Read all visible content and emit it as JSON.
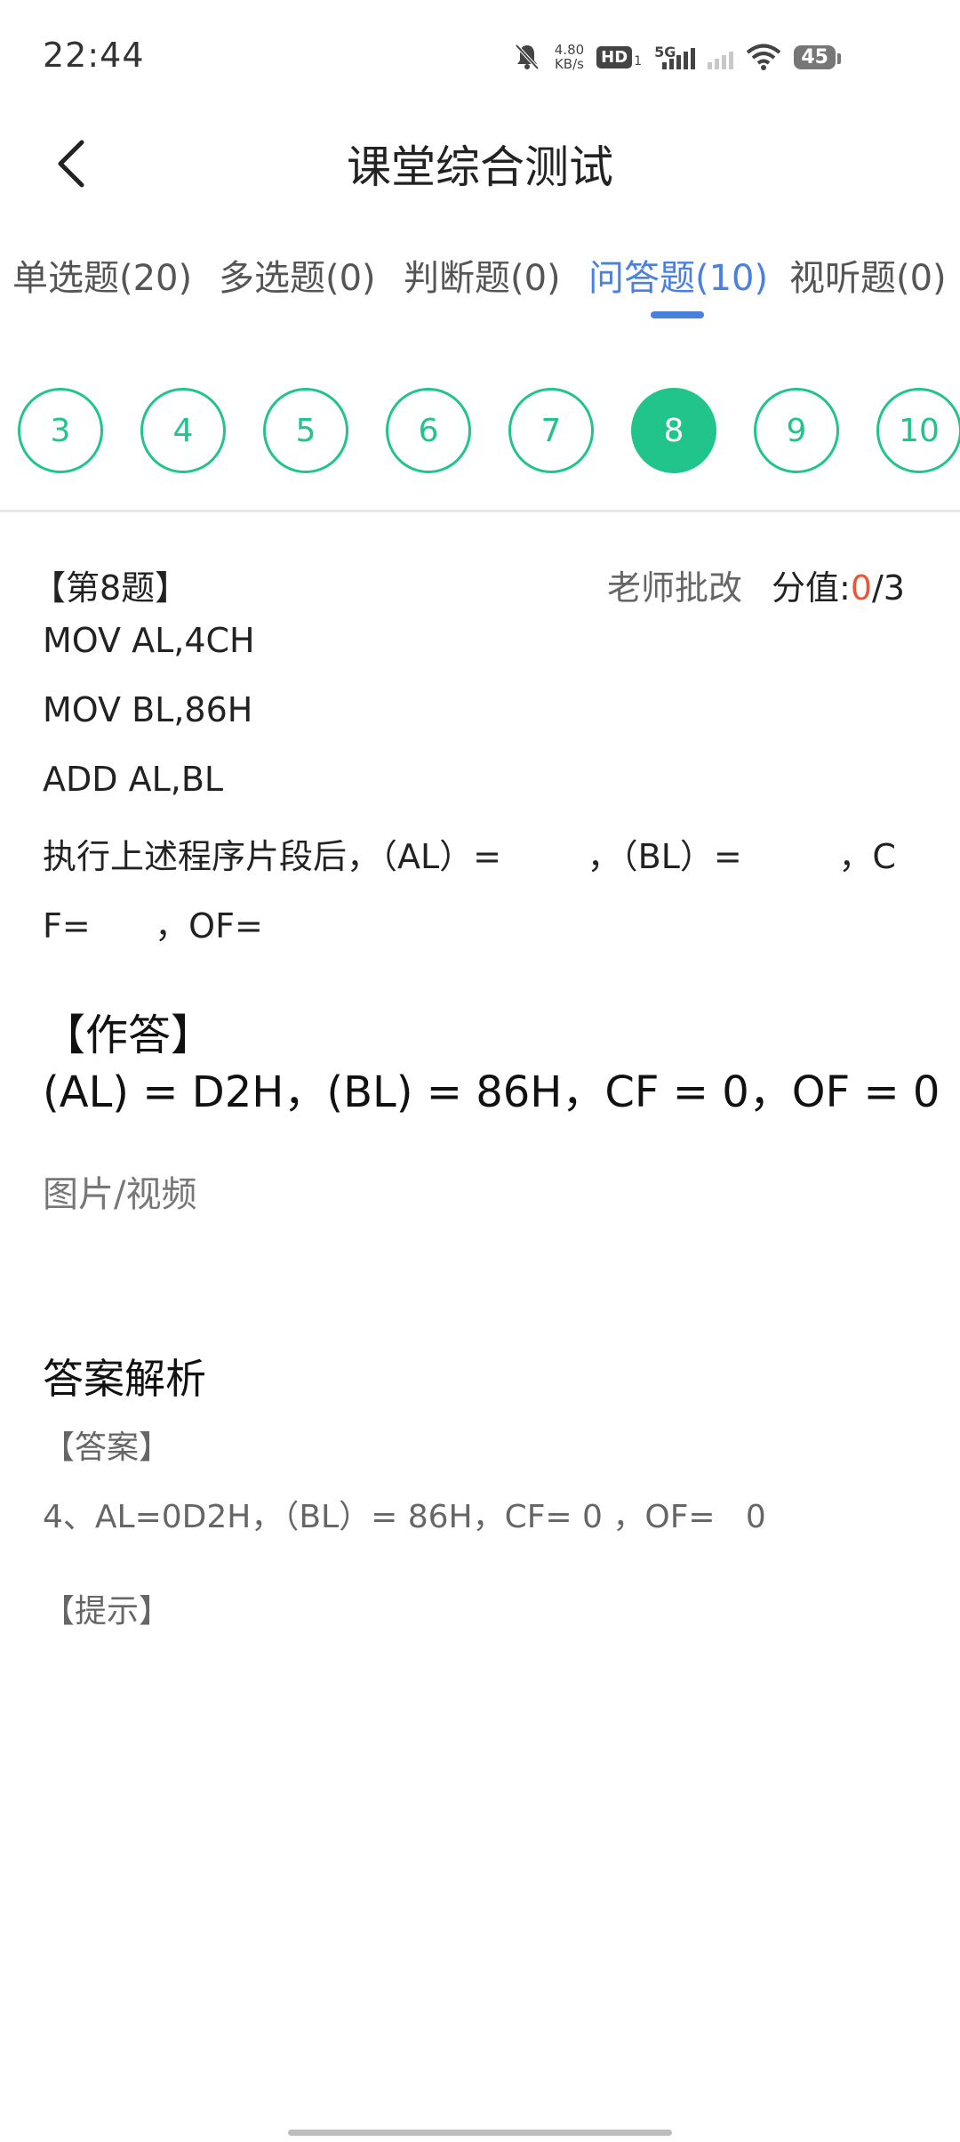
{
  "status_bar": {
    "time": "22:44",
    "net_speed_value": "4.80",
    "net_speed_unit": "KB/s",
    "hd_label": "HD",
    "hd_sub": "1",
    "network_type": "5G",
    "battery": "45"
  },
  "header": {
    "title": "课堂综合测试"
  },
  "tabs": [
    {
      "label": "单选题(20)"
    },
    {
      "label": "多选题(0)"
    },
    {
      "label": "判断题(0)"
    },
    {
      "label": "问答题(10)"
    },
    {
      "label": "视听题(0)"
    }
  ],
  "active_tab": 3,
  "question_nav": [
    "3",
    "4",
    "5",
    "6",
    "7",
    "8",
    "9",
    "10"
  ],
  "active_question": "8",
  "question": {
    "number_label": "【第8题】",
    "review_label": "老师批改",
    "score_label": "分值:",
    "score_got": "0",
    "score_total": "/3",
    "lines": [
      "MOV AL,4CH",
      "MOV BL,86H",
      "ADD AL,BL",
      "执行上述程序片段后，（AL）=        ，（BL）=         ，C",
      "F=      ，OF="
    ]
  },
  "my_answer": {
    "heading": "【作答】",
    "text": "(AL) = D2H，(BL) = 86H，CF = 0，OF = 0",
    "media_label": "图片/视频"
  },
  "analysis": {
    "heading": "答案解析",
    "answer_label": "【答案】",
    "answer_text": "4、AL=0D2H，（BL）= 86H，CF= 0 ，OF=   0",
    "hint_label": "【提示】"
  },
  "colors": {
    "accent_blue": "#4a80e0",
    "accent_green": "#21c48a",
    "score_red": "#e8573a"
  }
}
